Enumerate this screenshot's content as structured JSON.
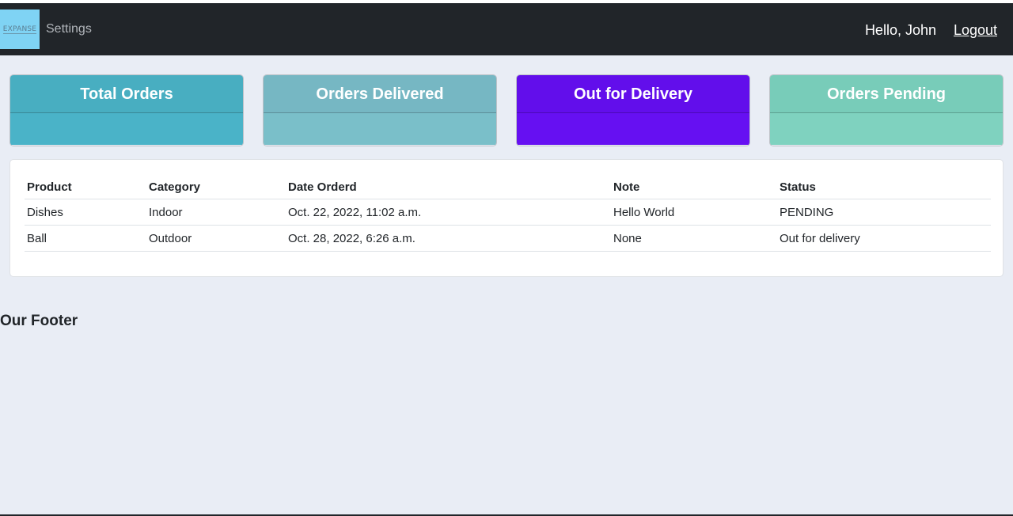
{
  "navbar": {
    "logo_text": "EXPANSE",
    "settings_label": "Settings",
    "greeting": "Hello, John",
    "logout_label": "Logout",
    "background": "#212529"
  },
  "cards": [
    {
      "title": "Total Orders",
      "value": "",
      "header_color": "#48aec1",
      "body_color": "#4ab3c8"
    },
    {
      "title": "Orders Delivered",
      "value": "",
      "header_color": "#76b7c3",
      "body_color": "#7abfc9"
    },
    {
      "title": "Out for Delivery",
      "value": "",
      "header_color": "#620eeb",
      "body_color": "#6610f2"
    },
    {
      "title": "Orders Pending",
      "value": "",
      "header_color": "#78ccb9",
      "body_color": "#7fd2bf"
    }
  ],
  "orders_table": {
    "headers": [
      "Product",
      "Category",
      "Date Orderd",
      "Note",
      "Status"
    ],
    "rows": [
      [
        "Dishes",
        "Indoor",
        "Oct. 22, 2022, 11:02 a.m.",
        "Hello World",
        "PENDING"
      ],
      [
        "Ball",
        "Outdoor",
        "Oct. 28, 2022, 6:26 a.m.",
        "None",
        "Out for delivery"
      ]
    ]
  },
  "footer": {
    "text": "Our Footer"
  }
}
